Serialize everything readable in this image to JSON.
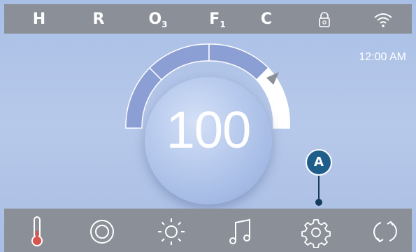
{
  "status_bar": {
    "indicators": [
      {
        "label": "H",
        "sub": ""
      },
      {
        "label": "R",
        "sub": ""
      },
      {
        "label": "O",
        "sub": "3"
      },
      {
        "label": "F",
        "sub": "1"
      },
      {
        "label": "C",
        "sub": ""
      }
    ],
    "icons": [
      "lock-icon",
      "wifi-icon"
    ]
  },
  "clock": {
    "time": "12:00 AM"
  },
  "gauge": {
    "temperature": "100"
  },
  "callout": {
    "label": "A"
  },
  "bottom_nav": {
    "buttons": [
      {
        "name": "thermometer-icon"
      },
      {
        "name": "jets-icon"
      },
      {
        "name": "light-icon"
      },
      {
        "name": "music-icon"
      },
      {
        "name": "settings-icon"
      },
      {
        "name": "refresh-icon"
      }
    ]
  },
  "colors": {
    "screen_bg": "#b2c5e9",
    "bar_bg": "#8a8f98",
    "callout": "#1f5d8a",
    "thermo_red": "#d9534f"
  }
}
